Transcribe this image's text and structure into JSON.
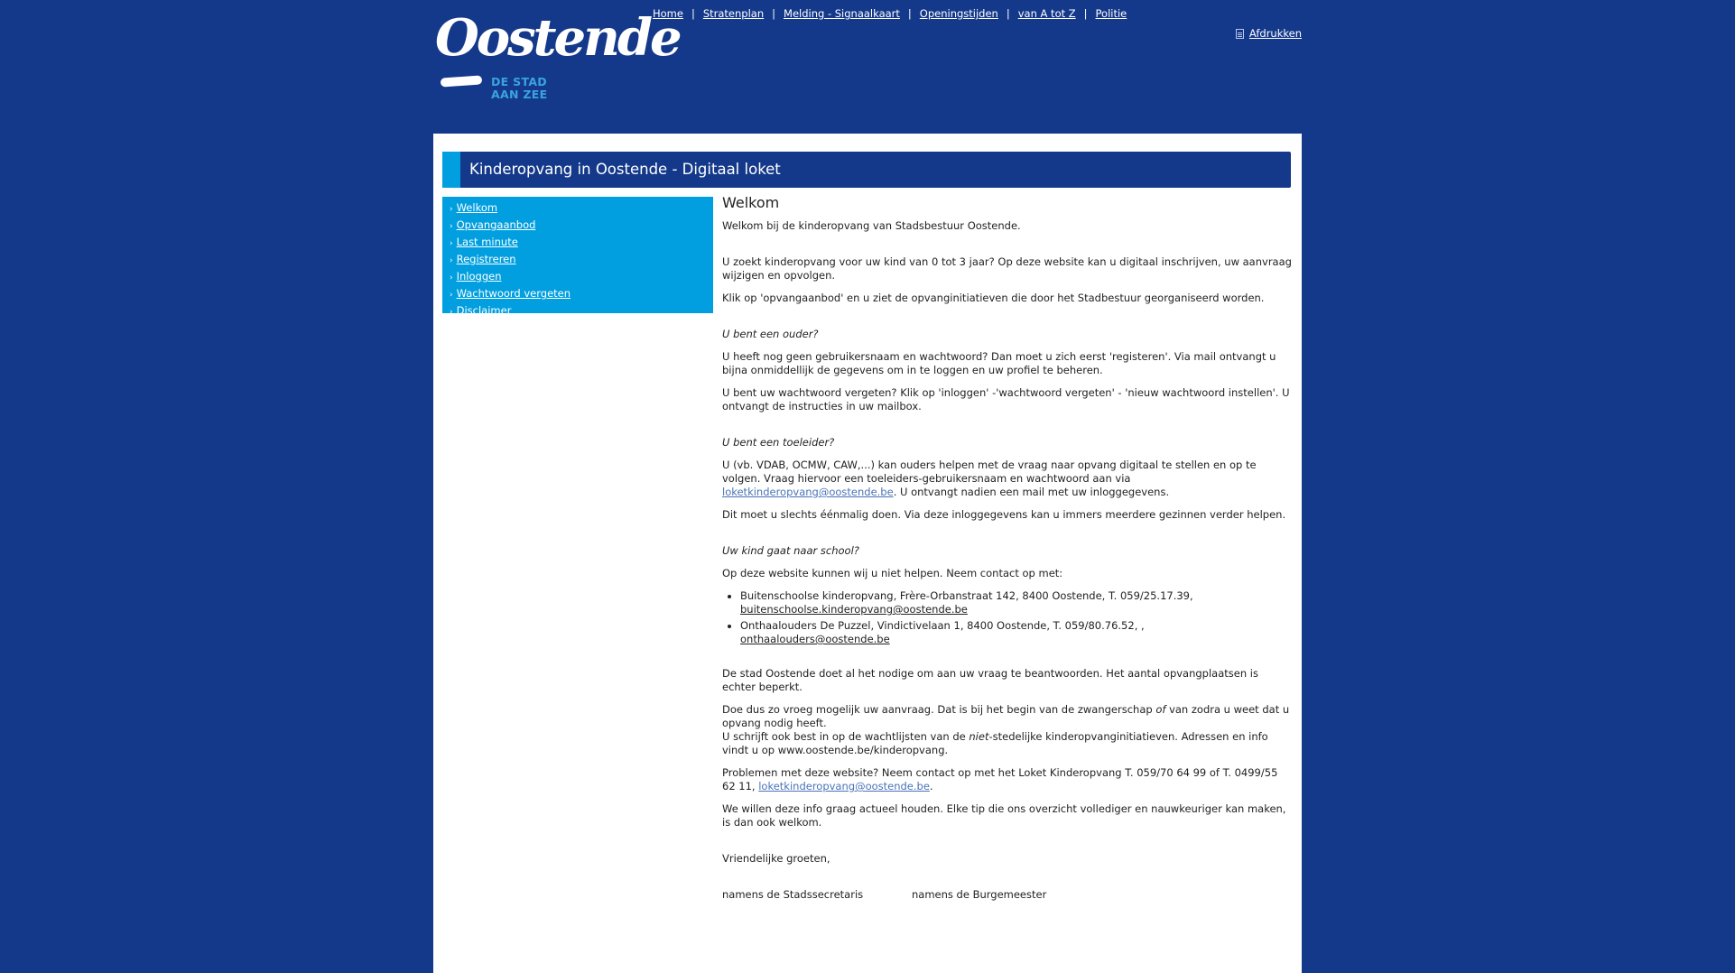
{
  "header": {
    "logo_word": "Oostende",
    "logo_tag_line1": "DE STAD",
    "logo_tag_line2": "AAN ZEE",
    "nav": [
      "Home",
      "Stratenplan",
      "Melding - Signaalkaart",
      "Openingstijden",
      "van A tot Z",
      "Politie"
    ],
    "nav_separator": "|",
    "print_label": "Afdrukken"
  },
  "page": {
    "title": "Kinderopvang in Oostende - Digitaal loket"
  },
  "sidebar": {
    "items": [
      "Welkom",
      "Opvangaanbod",
      "Last minute",
      "Registreren",
      "Inloggen",
      "Wachtwoord vergeten",
      "Disclaimer"
    ]
  },
  "content": {
    "heading": "Welkom",
    "intro": "Welkom bij de kinderopvang van Stadsbestuur Oostende.",
    "p1": "U zoekt kinderopvang voor uw kind van 0 tot 3 jaar? Op deze website kan u digitaal inschrijven, uw aanvraag wijzigen en opvolgen.",
    "p2": "Klik op 'opvangaanbod' en u ziet de opvanginitiatieven die door het Stadbestuur georganiseerd worden.",
    "q_parent": "U bent een ouder?",
    "parent_p1": "U heeft nog geen gebruikersnaam en wachtwoord? Dan moet u zich eerst 'registeren'. Via mail ontvangt u bijna onmiddellijk de gegevens om in te loggen en uw profiel te beheren.",
    "parent_p2": "U bent uw wachtwoord vergeten? Klik op 'inloggen' -'wachtwoord vergeten' - 'nieuw wachtwoord instellen'. U ontvangt de instructies in uw mailbox.",
    "q_guide": "U bent een toeleider?",
    "guide_p1_a": "U (vb. VDAB, OCMW, CAW,...) kan ouders helpen met de vraag naar opvang digitaal te stellen en op te volgen. Vraag hiervoor een toeleiders-gebruikersnaam en wachtwoord aan via ",
    "guide_p1_link": "loketkinderopvang@oostende.be",
    "guide_p1_b": ". U ontvangt nadien een mail met uw inloggegevens.",
    "guide_p2": "Dit moet u slechts éénmalig doen. Via deze inloggegevens kan u immers meerdere gezinnen verder helpen.",
    "q_school": "Uw kind gaat naar school?",
    "school_p": "Op deze website kunnen wij u niet helpen. Neem contact op met:",
    "school_list": [
      {
        "text": "Buitenschoolse kinderopvang, Frère-Orbanstraat 142, 8400 Oostende, T. 059/25.17.39, ",
        "link": "buitenschoolse.kinderopvang@oostende.be"
      },
      {
        "text": "Onthaalouders De Puzzel, Vindictivelaan 1, 8400 Oostende, T. 059/80.76.52, , ",
        "link": "onthaalouders@oostende.be"
      }
    ],
    "closing_p1": "De stad Oostende doet al het nodige om aan uw vraag te beantwoorden. Het aantal opvangplaatsen is echter beperkt.",
    "closing_p2_a": "Doe dus zo vroeg mogelijk uw aanvraag. Dat is bij het begin van de zwangerschap ",
    "closing_p2_of": "of",
    "closing_p2_b": " van zodra u weet dat u opvang nodig heeft.",
    "closing_p2_c": "U schrijft ook best in op de wachtlijsten van de ",
    "closing_p2_niet": "niet",
    "closing_p2_d": "-stedelijke kinderopvanginitiatieven. Adressen en info vindt u op www.oostende.be/kinderopvang.",
    "problems_a": "Problemen met deze website? Neem contact op met het Loket Kinderopvang T. 059/70 64 99 of  T. 0499/55 62 11, ",
    "problems_link": "loketkinderopvang@oostende.be",
    "problems_b": ".",
    "feedback": "We willen deze info graag actueel houden. Elke tip die ons overzicht vollediger en nauwkeuriger kan maken, is dan ook welkom.",
    "greeting": "Vriendelijke groeten,",
    "sign_left": "namens de Stadssecretaris",
    "sign_right": "namens de Burgemeester"
  },
  "colors": {
    "background": "#14398a",
    "accent_blue": "#019fdf",
    "link_blue": "#4a73b9",
    "panel": "#ffffff"
  }
}
